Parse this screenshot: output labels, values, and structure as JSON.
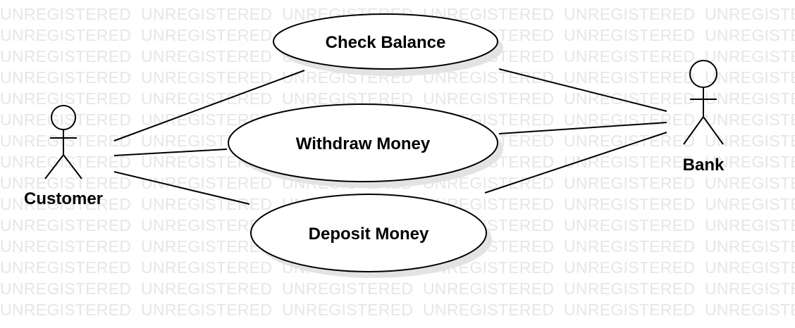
{
  "watermark": {
    "text": "UNREGISTERED"
  },
  "actors": {
    "customer": {
      "label": "Customer"
    },
    "bank": {
      "label": "Bank"
    }
  },
  "use_cases": {
    "check_balance": {
      "label": "Check Balance"
    },
    "withdraw_money": {
      "label": "Withdraw Money"
    },
    "deposit_money": {
      "label": "Deposit Money"
    }
  },
  "colors": {
    "line": "#000000",
    "watermark": "#e6e6e6",
    "shadow": "#e3e3e3",
    "background": "#ffffff"
  }
}
